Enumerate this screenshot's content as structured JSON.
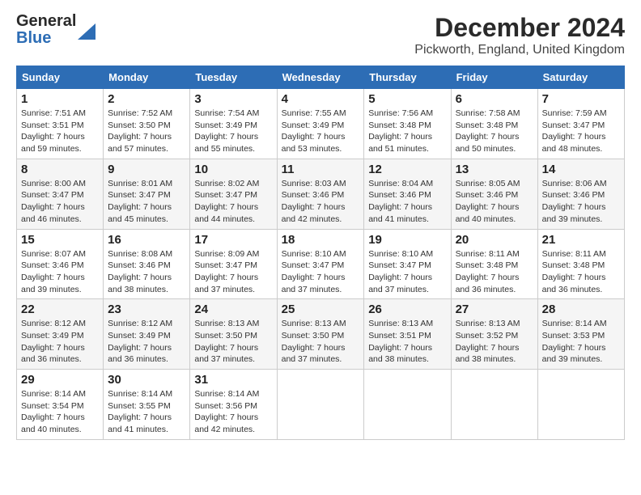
{
  "logo": {
    "line1": "General",
    "line2": "Blue"
  },
  "title": "December 2024",
  "location": "Pickworth, England, United Kingdom",
  "days_of_week": [
    "Sunday",
    "Monday",
    "Tuesday",
    "Wednesday",
    "Thursday",
    "Friday",
    "Saturday"
  ],
  "weeks": [
    [
      {
        "day": "1",
        "sunrise": "Sunrise: 7:51 AM",
        "sunset": "Sunset: 3:51 PM",
        "daylight": "Daylight: 7 hours and 59 minutes."
      },
      {
        "day": "2",
        "sunrise": "Sunrise: 7:52 AM",
        "sunset": "Sunset: 3:50 PM",
        "daylight": "Daylight: 7 hours and 57 minutes."
      },
      {
        "day": "3",
        "sunrise": "Sunrise: 7:54 AM",
        "sunset": "Sunset: 3:49 PM",
        "daylight": "Daylight: 7 hours and 55 minutes."
      },
      {
        "day": "4",
        "sunrise": "Sunrise: 7:55 AM",
        "sunset": "Sunset: 3:49 PM",
        "daylight": "Daylight: 7 hours and 53 minutes."
      },
      {
        "day": "5",
        "sunrise": "Sunrise: 7:56 AM",
        "sunset": "Sunset: 3:48 PM",
        "daylight": "Daylight: 7 hours and 51 minutes."
      },
      {
        "day": "6",
        "sunrise": "Sunrise: 7:58 AM",
        "sunset": "Sunset: 3:48 PM",
        "daylight": "Daylight: 7 hours and 50 minutes."
      },
      {
        "day": "7",
        "sunrise": "Sunrise: 7:59 AM",
        "sunset": "Sunset: 3:47 PM",
        "daylight": "Daylight: 7 hours and 48 minutes."
      }
    ],
    [
      {
        "day": "8",
        "sunrise": "Sunrise: 8:00 AM",
        "sunset": "Sunset: 3:47 PM",
        "daylight": "Daylight: 7 hours and 46 minutes."
      },
      {
        "day": "9",
        "sunrise": "Sunrise: 8:01 AM",
        "sunset": "Sunset: 3:47 PM",
        "daylight": "Daylight: 7 hours and 45 minutes."
      },
      {
        "day": "10",
        "sunrise": "Sunrise: 8:02 AM",
        "sunset": "Sunset: 3:47 PM",
        "daylight": "Daylight: 7 hours and 44 minutes."
      },
      {
        "day": "11",
        "sunrise": "Sunrise: 8:03 AM",
        "sunset": "Sunset: 3:46 PM",
        "daylight": "Daylight: 7 hours and 42 minutes."
      },
      {
        "day": "12",
        "sunrise": "Sunrise: 8:04 AM",
        "sunset": "Sunset: 3:46 PM",
        "daylight": "Daylight: 7 hours and 41 minutes."
      },
      {
        "day": "13",
        "sunrise": "Sunrise: 8:05 AM",
        "sunset": "Sunset: 3:46 PM",
        "daylight": "Daylight: 7 hours and 40 minutes."
      },
      {
        "day": "14",
        "sunrise": "Sunrise: 8:06 AM",
        "sunset": "Sunset: 3:46 PM",
        "daylight": "Daylight: 7 hours and 39 minutes."
      }
    ],
    [
      {
        "day": "15",
        "sunrise": "Sunrise: 8:07 AM",
        "sunset": "Sunset: 3:46 PM",
        "daylight": "Daylight: 7 hours and 39 minutes."
      },
      {
        "day": "16",
        "sunrise": "Sunrise: 8:08 AM",
        "sunset": "Sunset: 3:46 PM",
        "daylight": "Daylight: 7 hours and 38 minutes."
      },
      {
        "day": "17",
        "sunrise": "Sunrise: 8:09 AM",
        "sunset": "Sunset: 3:47 PM",
        "daylight": "Daylight: 7 hours and 37 minutes."
      },
      {
        "day": "18",
        "sunrise": "Sunrise: 8:10 AM",
        "sunset": "Sunset: 3:47 PM",
        "daylight": "Daylight: 7 hours and 37 minutes."
      },
      {
        "day": "19",
        "sunrise": "Sunrise: 8:10 AM",
        "sunset": "Sunset: 3:47 PM",
        "daylight": "Daylight: 7 hours and 37 minutes."
      },
      {
        "day": "20",
        "sunrise": "Sunrise: 8:11 AM",
        "sunset": "Sunset: 3:48 PM",
        "daylight": "Daylight: 7 hours and 36 minutes."
      },
      {
        "day": "21",
        "sunrise": "Sunrise: 8:11 AM",
        "sunset": "Sunset: 3:48 PM",
        "daylight": "Daylight: 7 hours and 36 minutes."
      }
    ],
    [
      {
        "day": "22",
        "sunrise": "Sunrise: 8:12 AM",
        "sunset": "Sunset: 3:49 PM",
        "daylight": "Daylight: 7 hours and 36 minutes."
      },
      {
        "day": "23",
        "sunrise": "Sunrise: 8:12 AM",
        "sunset": "Sunset: 3:49 PM",
        "daylight": "Daylight: 7 hours and 36 minutes."
      },
      {
        "day": "24",
        "sunrise": "Sunrise: 8:13 AM",
        "sunset": "Sunset: 3:50 PM",
        "daylight": "Daylight: 7 hours and 37 minutes."
      },
      {
        "day": "25",
        "sunrise": "Sunrise: 8:13 AM",
        "sunset": "Sunset: 3:50 PM",
        "daylight": "Daylight: 7 hours and 37 minutes."
      },
      {
        "day": "26",
        "sunrise": "Sunrise: 8:13 AM",
        "sunset": "Sunset: 3:51 PM",
        "daylight": "Daylight: 7 hours and 38 minutes."
      },
      {
        "day": "27",
        "sunrise": "Sunrise: 8:13 AM",
        "sunset": "Sunset: 3:52 PM",
        "daylight": "Daylight: 7 hours and 38 minutes."
      },
      {
        "day": "28",
        "sunrise": "Sunrise: 8:14 AM",
        "sunset": "Sunset: 3:53 PM",
        "daylight": "Daylight: 7 hours and 39 minutes."
      }
    ],
    [
      {
        "day": "29",
        "sunrise": "Sunrise: 8:14 AM",
        "sunset": "Sunset: 3:54 PM",
        "daylight": "Daylight: 7 hours and 40 minutes."
      },
      {
        "day": "30",
        "sunrise": "Sunrise: 8:14 AM",
        "sunset": "Sunset: 3:55 PM",
        "daylight": "Daylight: 7 hours and 41 minutes."
      },
      {
        "day": "31",
        "sunrise": "Sunrise: 8:14 AM",
        "sunset": "Sunset: 3:56 PM",
        "daylight": "Daylight: 7 hours and 42 minutes."
      },
      null,
      null,
      null,
      null
    ]
  ]
}
